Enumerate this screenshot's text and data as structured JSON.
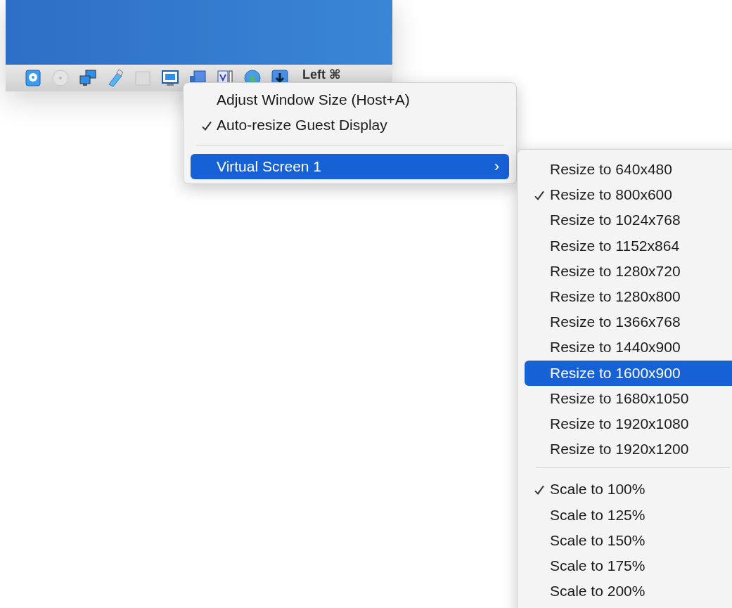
{
  "status_bar": {
    "host_key": "Left ⌘"
  },
  "menu": {
    "items": [
      {
        "kind": "item",
        "label": "Adjust Window Size (Host+A)",
        "checked": false,
        "selected": false
      },
      {
        "kind": "item",
        "label": "Auto-resize Guest Display",
        "checked": true,
        "selected": false
      },
      {
        "kind": "separator"
      },
      {
        "kind": "submenu",
        "label": "Virtual Screen 1",
        "checked": false,
        "selected": true,
        "arrow": "›"
      }
    ]
  },
  "submenu": {
    "items": [
      {
        "kind": "item",
        "label": "Resize to 640x480",
        "checked": false,
        "selected": false
      },
      {
        "kind": "item",
        "label": "Resize to 800x600",
        "checked": true,
        "selected": false
      },
      {
        "kind": "item",
        "label": "Resize to 1024x768",
        "checked": false,
        "selected": false
      },
      {
        "kind": "item",
        "label": "Resize to 1152x864",
        "checked": false,
        "selected": false
      },
      {
        "kind": "item",
        "label": "Resize to 1280x720",
        "checked": false,
        "selected": false
      },
      {
        "kind": "item",
        "label": "Resize to 1280x800",
        "checked": false,
        "selected": false
      },
      {
        "kind": "item",
        "label": "Resize to 1366x768",
        "checked": false,
        "selected": false
      },
      {
        "kind": "item",
        "label": "Resize to 1440x900",
        "checked": false,
        "selected": false
      },
      {
        "kind": "item",
        "label": "Resize to 1600x900",
        "checked": false,
        "selected": true
      },
      {
        "kind": "item",
        "label": "Resize to 1680x1050",
        "checked": false,
        "selected": false
      },
      {
        "kind": "item",
        "label": "Resize to 1920x1080",
        "checked": false,
        "selected": false
      },
      {
        "kind": "item",
        "label": "Resize to 1920x1200",
        "checked": false,
        "selected": false
      },
      {
        "kind": "separator"
      },
      {
        "kind": "item",
        "label": "Scale to 100%",
        "checked": true,
        "selected": false
      },
      {
        "kind": "item",
        "label": "Scale to 125%",
        "checked": false,
        "selected": false
      },
      {
        "kind": "item",
        "label": "Scale to 150%",
        "checked": false,
        "selected": false
      },
      {
        "kind": "item",
        "label": "Scale to 175%",
        "checked": false,
        "selected": false
      },
      {
        "kind": "item",
        "label": "Scale to 200%",
        "checked": false,
        "selected": false
      }
    ]
  }
}
